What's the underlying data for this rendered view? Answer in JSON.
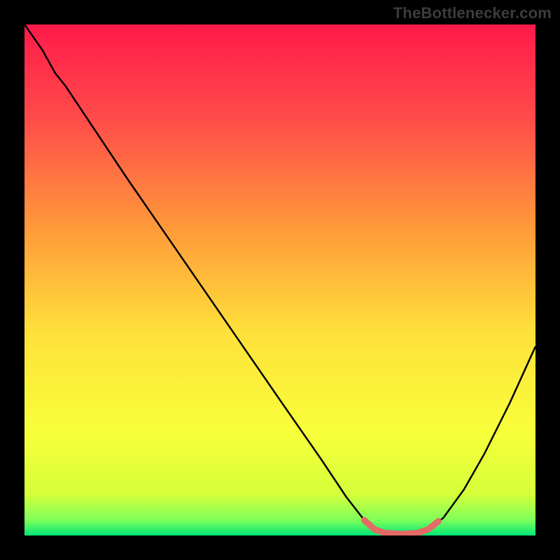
{
  "watermark": "TheBottlenecker.com",
  "chart_data": {
    "type": "line",
    "title": "",
    "xlabel": "",
    "ylabel": "",
    "xlim": [
      0,
      100
    ],
    "ylim": [
      0,
      100
    ],
    "gradient_stops": [
      {
        "offset": 0,
        "color": "#ff1a4a"
      },
      {
        "offset": 18,
        "color": "#ff4a4a"
      },
      {
        "offset": 40,
        "color": "#ff9a3a"
      },
      {
        "offset": 60,
        "color": "#ffe03a"
      },
      {
        "offset": 80,
        "color": "#f7ff3a"
      },
      {
        "offset": 92,
        "color": "#d4ff3a"
      },
      {
        "offset": 97,
        "color": "#7dff5a"
      },
      {
        "offset": 100,
        "color": "#00e676"
      }
    ],
    "series": [
      {
        "name": "bottleneck-curve",
        "color": "#000000",
        "width": 2.5,
        "points": [
          {
            "x": 0.0,
            "y": 100.0
          },
          {
            "x": 3.5,
            "y": 95.0
          },
          {
            "x": 6.0,
            "y": 90.5
          },
          {
            "x": 8.0,
            "y": 88.0
          },
          {
            "x": 12.0,
            "y": 82.0
          },
          {
            "x": 20.0,
            "y": 70.0
          },
          {
            "x": 30.0,
            "y": 55.5
          },
          {
            "x": 40.0,
            "y": 41.0
          },
          {
            "x": 50.0,
            "y": 26.5
          },
          {
            "x": 58.0,
            "y": 15.0
          },
          {
            "x": 63.0,
            "y": 7.5
          },
          {
            "x": 66.5,
            "y": 3.0
          },
          {
            "x": 69.0,
            "y": 1.0
          },
          {
            "x": 72.0,
            "y": 0.3
          },
          {
            "x": 76.0,
            "y": 0.3
          },
          {
            "x": 79.0,
            "y": 1.0
          },
          {
            "x": 82.0,
            "y": 3.5
          },
          {
            "x": 86.0,
            "y": 9.0
          },
          {
            "x": 90.0,
            "y": 16.0
          },
          {
            "x": 95.0,
            "y": 26.0
          },
          {
            "x": 100.0,
            "y": 37.0
          }
        ]
      },
      {
        "name": "optimal-range-marker",
        "color": "#e36a66",
        "width": 9,
        "linecap": "round",
        "points": [
          {
            "x": 66.5,
            "y": 3.0
          },
          {
            "x": 68.5,
            "y": 1.2
          },
          {
            "x": 70.5,
            "y": 0.5
          },
          {
            "x": 74.0,
            "y": 0.3
          },
          {
            "x": 77.0,
            "y": 0.5
          },
          {
            "x": 79.0,
            "y": 1.2
          },
          {
            "x": 81.0,
            "y": 2.8
          }
        ]
      }
    ]
  }
}
